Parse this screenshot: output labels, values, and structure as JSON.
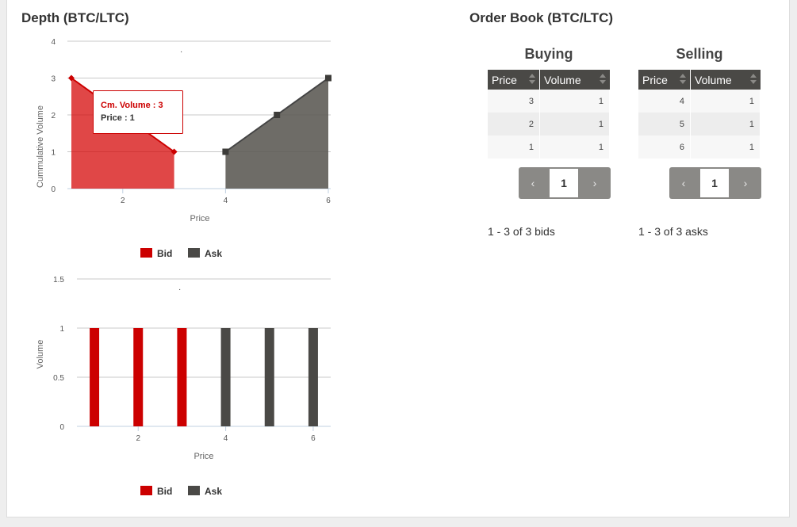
{
  "depth": {
    "title": "Depth (BTC/LTC)",
    "tooltip": {
      "line1": "Cm. Volume : 3",
      "line2": "Price : 1"
    }
  },
  "legend": {
    "bid": "Bid",
    "ask": "Ask"
  },
  "colors": {
    "bid": "#cc0000",
    "ask": "#4a4946"
  },
  "chart_data": [
    {
      "type": "area",
      "xlabel": "Price",
      "ylabel": "Cummulative Volume",
      "xlim": [
        1,
        6
      ],
      "ylim": [
        0,
        4
      ],
      "xticks": [
        "2",
        "4",
        "6"
      ],
      "yticks": [
        "0",
        "1",
        "2",
        "3",
        "4"
      ],
      "legend_position": "bottom",
      "grid": true,
      "series": [
        {
          "name": "Bid",
          "x": [
            1,
            2,
            3
          ],
          "y": [
            3,
            2,
            1
          ]
        },
        {
          "name": "Ask",
          "x": [
            4,
            5,
            6
          ],
          "y": [
            1,
            2,
            3
          ]
        }
      ]
    },
    {
      "type": "bar",
      "xlabel": "Price",
      "ylabel": "Volume",
      "xlim": [
        0.6,
        6.4
      ],
      "ylim": [
        0,
        1.5
      ],
      "xticks": [
        "2",
        "4",
        "6"
      ],
      "yticks": [
        "0",
        "0.5",
        "1",
        "1.5"
      ],
      "legend_position": "bottom",
      "grid": true,
      "series": [
        {
          "name": "Bid",
          "x": [
            1,
            2,
            3
          ],
          "y": [
            1,
            1,
            1
          ]
        },
        {
          "name": "Ask",
          "x": [
            4,
            5,
            6
          ],
          "y": [
            1,
            1,
            1
          ]
        }
      ]
    }
  ],
  "orderbook": {
    "title": "Order Book (BTC/LTC)",
    "buying": {
      "title": "Buying",
      "columns": [
        "Price",
        "Volume"
      ],
      "rows": [
        [
          "3",
          "1"
        ],
        [
          "2",
          "1"
        ],
        [
          "1",
          "1"
        ]
      ],
      "prev": "‹",
      "page": "1",
      "next": "›",
      "count": "1 - 3 of 3 bids"
    },
    "selling": {
      "title": "Selling",
      "columns": [
        "Price",
        "Volume"
      ],
      "rows": [
        [
          "4",
          "1"
        ],
        [
          "5",
          "1"
        ],
        [
          "6",
          "1"
        ]
      ],
      "prev": "‹",
      "page": "1",
      "next": "›",
      "count": "1 - 3 of 3 asks"
    }
  }
}
